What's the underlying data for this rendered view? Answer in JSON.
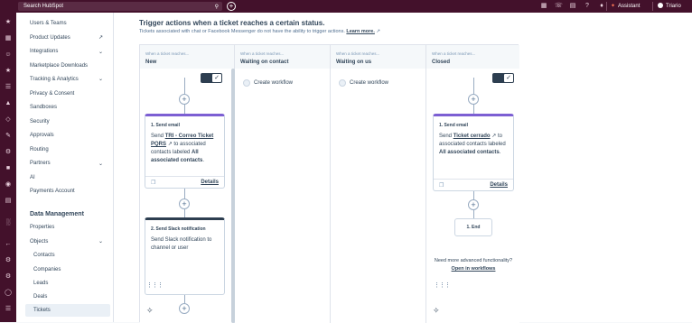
{
  "topbar": {
    "search_placeholder": "Search HubSpot",
    "assistant_label": "Assistant",
    "account_name": "Triario",
    "icons": [
      "search-icon",
      "add-icon",
      "grid-icon",
      "phone-icon",
      "store-icon",
      "help-icon",
      "settings-icon",
      "notifications-icon"
    ]
  },
  "sidebar": {
    "items": [
      {
        "label": "Users & Teams"
      },
      {
        "label": "Product Updates",
        "external": true
      },
      {
        "label": "Integrations",
        "chevron": true
      },
      {
        "label": "Marketplace Downloads"
      },
      {
        "label": "Tracking & Analytics",
        "chevron": true
      },
      {
        "label": "Privacy & Consent"
      },
      {
        "label": "Sandboxes"
      },
      {
        "label": "Security"
      },
      {
        "label": "Approvals"
      },
      {
        "label": "Routing"
      },
      {
        "label": "Partners",
        "chevron": true
      },
      {
        "label": "AI"
      },
      {
        "label": "Payments Account"
      }
    ],
    "section_title": "Data Management",
    "data_items": [
      {
        "label": "Properties"
      },
      {
        "label": "Objects",
        "chevron": true
      }
    ],
    "object_items": [
      {
        "label": "Contacts"
      },
      {
        "label": "Companies"
      },
      {
        "label": "Leads"
      },
      {
        "label": "Deals"
      },
      {
        "label": "Tickets",
        "active": true
      }
    ]
  },
  "main": {
    "title": "Trigger actions when a ticket reaches a certain status.",
    "subtitle": "Tickets associated with chat or Facebook Messenger do not have the ability to trigger actions.",
    "learn_more": "Learn more.",
    "columns": [
      {
        "caption": "When a ticket reaches...",
        "name": "New"
      },
      {
        "caption": "When a ticket reaches...",
        "name": "Waiting on contact"
      },
      {
        "caption": "When a ticket reaches...",
        "name": "Waiting on us"
      },
      {
        "caption": "When a ticket reaches...",
        "name": "Closed"
      }
    ],
    "create_workflow": "Create workflow",
    "new_card1": {
      "title": "1. Send email",
      "line1": "Send",
      "link": "TRI - Correo Ticket PQRS",
      "line2": "to associated contacts labeled",
      "bold": "All associated contacts",
      "details": "Details"
    },
    "new_card2": {
      "title": "2. Send Slack notification",
      "body": "Send Slack notification to channel or user"
    },
    "closed_card": {
      "title": "1. Send email",
      "line1": "Send",
      "link": "Ticket cerrado",
      "line2": "to associated contacts labeled",
      "bold": "All associated contacts",
      "details": "Details"
    },
    "end_label": "1. End",
    "advanced_text": "Need more advanced functionality?",
    "advanced_link": "Open in workflows"
  }
}
